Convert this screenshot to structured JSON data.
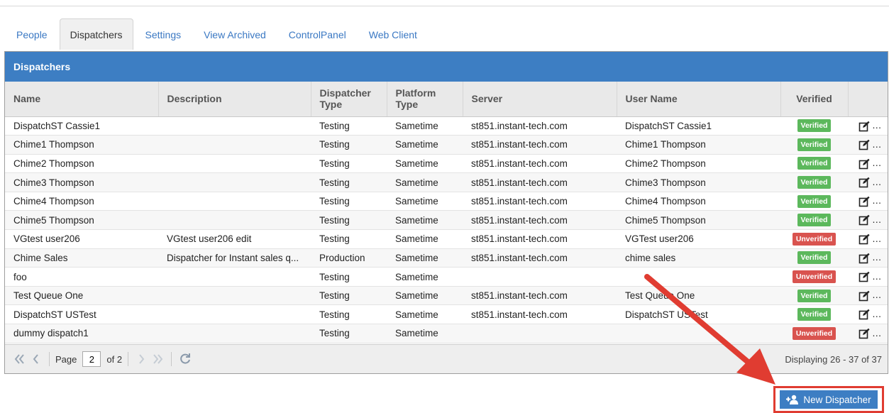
{
  "tabs": [
    {
      "label": "People"
    },
    {
      "label": "Dispatchers",
      "active": true
    },
    {
      "label": "Settings"
    },
    {
      "label": "View Archived"
    },
    {
      "label": "ControlPanel"
    },
    {
      "label": "Web Client"
    }
  ],
  "panel": {
    "title": "Dispatchers",
    "columns": [
      "Name",
      "Description",
      "Dispatcher Type",
      "Platform Type",
      "Server",
      "User Name",
      "Verified",
      ""
    ],
    "rows": [
      {
        "name": "DispatchST Cassie1",
        "description": "",
        "dispatcher_type": "Testing",
        "platform_type": "Sametime",
        "server": "st851.instant-tech.com",
        "user_name": "DispatchST Cassie1",
        "verified": "Verified"
      },
      {
        "name": "Chime1 Thompson",
        "description": "",
        "dispatcher_type": "Testing",
        "platform_type": "Sametime",
        "server": "st851.instant-tech.com",
        "user_name": "Chime1 Thompson",
        "verified": "Verified"
      },
      {
        "name": "Chime2 Thompson",
        "description": "",
        "dispatcher_type": "Testing",
        "platform_type": "Sametime",
        "server": "st851.instant-tech.com",
        "user_name": "Chime2 Thompson",
        "verified": "Verified"
      },
      {
        "name": "Chime3 Thompson",
        "description": "",
        "dispatcher_type": "Testing",
        "platform_type": "Sametime",
        "server": "st851.instant-tech.com",
        "user_name": "Chime3 Thompson",
        "verified": "Verified"
      },
      {
        "name": "Chime4 Thompson",
        "description": "",
        "dispatcher_type": "Testing",
        "platform_type": "Sametime",
        "server": "st851.instant-tech.com",
        "user_name": "Chime4 Thompson",
        "verified": "Verified"
      },
      {
        "name": "Chime5 Thompson",
        "description": "",
        "dispatcher_type": "Testing",
        "platform_type": "Sametime",
        "server": "st851.instant-tech.com",
        "user_name": "Chime5 Thompson",
        "verified": "Verified"
      },
      {
        "name": "VGtest user206",
        "description": "VGtest user206 edit",
        "dispatcher_type": "Testing",
        "platform_type": "Sametime",
        "server": "st851.instant-tech.com",
        "user_name": "VGTest user206",
        "verified": "Unverified"
      },
      {
        "name": "Chime Sales",
        "description": "Dispatcher for Instant sales q...",
        "dispatcher_type": "Production",
        "platform_type": "Sametime",
        "server": "st851.instant-tech.com",
        "user_name": "chime sales",
        "verified": "Verified"
      },
      {
        "name": "foo",
        "description": "",
        "dispatcher_type": "Testing",
        "platform_type": "Sametime",
        "server": "",
        "user_name": "",
        "verified": "Unverified"
      },
      {
        "name": "Test Queue One",
        "description": "",
        "dispatcher_type": "Testing",
        "platform_type": "Sametime",
        "server": "st851.instant-tech.com",
        "user_name": "Test Queue One",
        "verified": "Verified"
      },
      {
        "name": "DispatchST USTest",
        "description": "",
        "dispatcher_type": "Testing",
        "platform_type": "Sametime",
        "server": "st851.instant-tech.com",
        "user_name": "DispatchST USTest",
        "verified": "Verified"
      },
      {
        "name": "dummy dispatch1",
        "description": "",
        "dispatcher_type": "Testing",
        "platform_type": "Sametime",
        "server": "",
        "user_name": "",
        "verified": "Unverified"
      }
    ]
  },
  "pager": {
    "page_label": "Page",
    "page_value": "2",
    "of_label": "of 2",
    "display_text": "Displaying 26 - 37 of 37"
  },
  "new_button": {
    "label": "New Dispatcher"
  },
  "colors": {
    "header_blue": "#3d7ec3",
    "verified": "#5cb85c",
    "unverified": "#d9534f",
    "annotation_red": "#e03c31"
  }
}
